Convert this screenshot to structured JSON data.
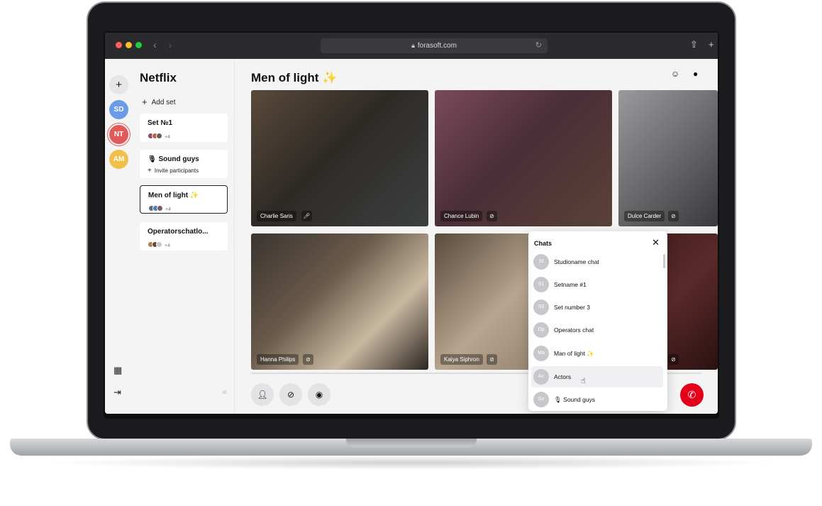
{
  "browser": {
    "url": "forasoft.com",
    "lock_icon": "lock-icon",
    "traffic_lights": [
      "#ff5f57",
      "#febc2e",
      "#28c840"
    ]
  },
  "rail": {
    "add_label": "+",
    "workspaces": [
      {
        "initials": "SD",
        "color": "#6b9be8"
      },
      {
        "initials": "NT",
        "color": "#e05a5a"
      },
      {
        "initials": "AM",
        "color": "#f0c04a"
      }
    ]
  },
  "sidebar": {
    "title": "Netflix",
    "add_set_label": "Add set",
    "sets": [
      {
        "name": "Set №1",
        "more": "+4"
      },
      {
        "name": "🎙 Sound guys",
        "invite": "Invite participants"
      },
      {
        "name": "Men of light ✨",
        "more": "+4"
      },
      {
        "name": "Operatorschatlo...",
        "more": "+4"
      }
    ],
    "collapse": "«"
  },
  "main": {
    "title": "Men of light ✨",
    "tiles": [
      {
        "name": "Charlie Saris"
      },
      {
        "name": "Chance Lubin"
      },
      {
        "name": "Dulce Carder"
      },
      {
        "name": "Hanna Philips"
      },
      {
        "name": "Kaiya Siphron"
      }
    ]
  },
  "chats": {
    "title": "Chats",
    "close": "✕",
    "items": [
      {
        "initials": "St",
        "name": "Studioname chat"
      },
      {
        "initials": "S1",
        "name": "Setname #1"
      },
      {
        "initials": "S3",
        "name": "Set number 3"
      },
      {
        "initials": "Op",
        "name": "Operators chat"
      },
      {
        "initials": "Ma",
        "name": "Man of light ✨"
      },
      {
        "initials": "Ac",
        "name": "Actors"
      },
      {
        "initials": "So",
        "name": "🎙 Sound guys"
      }
    ]
  },
  "colors": {
    "accent_hangup": "#e4001b",
    "active_border": "#222222"
  }
}
